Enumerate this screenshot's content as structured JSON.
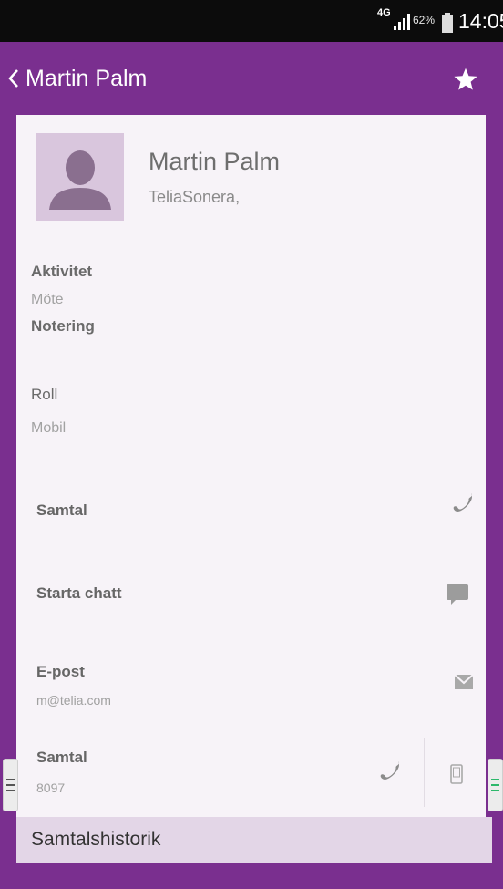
{
  "status_bar": {
    "network_type": "4G",
    "battery_percent": "62%",
    "time": "14:05"
  },
  "app_bar": {
    "title": "Martin Palm"
  },
  "contact": {
    "name": "Martin Palm",
    "company": "TeliaSonera,"
  },
  "fields": {
    "activity_label": "Aktivitet",
    "activity_value": "Möte",
    "note_label": "Notering",
    "role_label": "Roll",
    "role_value": "Mobil"
  },
  "actions": [
    {
      "label": "Samtal",
      "sub": "",
      "icon": "phone-icon"
    },
    {
      "label": "Starta chatt",
      "sub": "",
      "icon": "chat-icon"
    },
    {
      "label": "E-post",
      "sub": "m@telia.com",
      "icon": "mail-icon"
    },
    {
      "label": "Samtal",
      "sub": "8097",
      "icon": "phone-icon",
      "secondary_icon": "mobile-icon"
    }
  ],
  "bottom": {
    "history_label": "Samtalshistorik"
  },
  "colors": {
    "brand_purple": "#7a2f8f",
    "card_background": "#f7f3f8",
    "history_bar": "#e3d6e7",
    "accent_green": "#2db86b"
  }
}
